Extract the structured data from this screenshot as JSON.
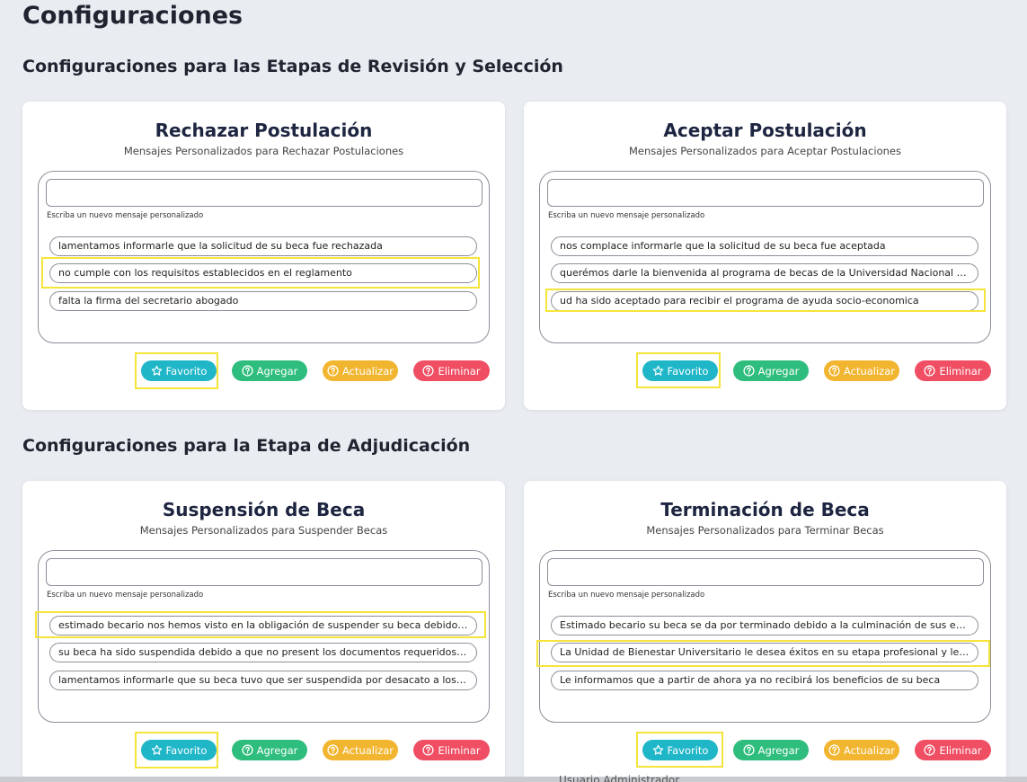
{
  "page": {
    "title": "Configuraciones"
  },
  "sections": [
    {
      "title": "Configuraciones para las Etapas de Revisión y Selección"
    },
    {
      "title": "Configuraciones para la Etapa de Adjudicación"
    }
  ],
  "cards": [
    {
      "title": "Rechazar Postulación",
      "subtitle": "Mensajes Personalizados para Rechazar Postulaciones",
      "input_value": "",
      "hint": "Escriba un nuevo mensaje personalizado",
      "messages": [
        "lamentamos informarle que la solicitud de su beca fue rechazada",
        "no cumple con los requisitos establecidos en el reglamento",
        "falta la firma del secretario abogado"
      ]
    },
    {
      "title": "Aceptar Postulación",
      "subtitle": "Mensajes Personalizados para Aceptar Postulaciones",
      "input_value": "",
      "hint": "Escriba un nuevo mensaje personalizado",
      "messages": [
        "nos complace informarle que la solicitud de su beca fue aceptada",
        "querémos darle la bienvenida al programa de becas de la Universidad Nacional de L...",
        "ud ha sido aceptado para recibir el programa de ayuda socio-economica"
      ]
    },
    {
      "title": "Suspensión de Beca",
      "subtitle": "Mensajes Personalizados para Suspender Becas",
      "input_value": "",
      "hint": "Escriba un nuevo mensaje personalizado",
      "messages": [
        "estimado becario nos hemos visto en la obligación de suspender su beca debido a...",
        "su beca ha sido suspendida debido a que no present los documentos requeridos en ...",
        "lamentamos informarle que su beca tuvo que ser suspendida por desacato a los ..."
      ]
    },
    {
      "title": "Terminación de Beca",
      "subtitle": "Mensajes Personalizados para Terminar Becas",
      "input_value": "",
      "hint": "Escriba un nuevo mensaje personalizado",
      "messages": [
        "Estimado becario su beca se da por terminado debido a la culminación de sus estud...",
        "La Unidad de Bienestar Universitario le desea éxitos en su etapa profesional y le info...",
        "Le informamos que a partir de ahora ya no recibirá los beneficios de su beca"
      ]
    }
  ],
  "buttons": {
    "favorite": "Favorito",
    "add": "Agregar",
    "update": "Actualizar",
    "delete": "Eliminar"
  },
  "icons": {
    "favorite": "star-outline-icon",
    "action": "question-circle-icon"
  },
  "colors": {
    "favorite": "#1fb6c8",
    "add": "#2ebd7c",
    "update": "#f2b52f",
    "delete": "#ef4e63",
    "highlight": "#f5e43a"
  },
  "footer": {
    "partial_text": "Usuario Administrador"
  }
}
